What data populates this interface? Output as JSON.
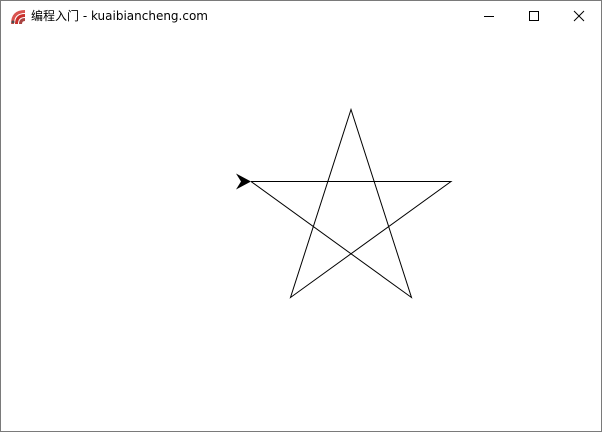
{
  "window": {
    "title": "编程入门 - kuaibiancheng.com",
    "app_icon": "python-turtle-icon"
  },
  "titlebar_controls": {
    "minimize_icon": "minimize-icon",
    "maximize_icon": "maximize-icon",
    "close_icon": "close-icon"
  },
  "drawing": {
    "shape": "five-pointed star",
    "stroke_color": "#000000",
    "cursor_icon": "turtle-arrow-cursor-icon",
    "cursor_color": "#000000"
  }
}
